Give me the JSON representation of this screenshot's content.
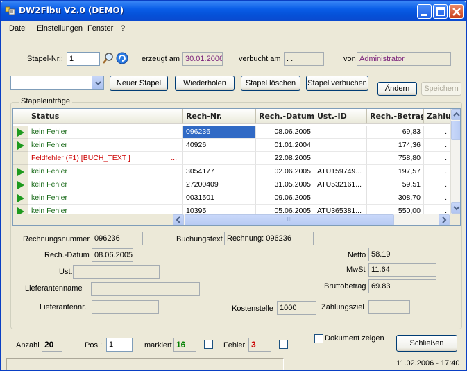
{
  "window": {
    "title": "DW2Fibu V2.0 (DEMO)"
  },
  "menu": [
    "Datei",
    "Einstellungen",
    "Fenster",
    "?"
  ],
  "header": {
    "stapel_label": "Stapel-Nr.:",
    "stapel_value": "1",
    "erzeugt_label": "erzeugt am",
    "erzeugt_value": "30.01.2006",
    "verbucht_label": "verbucht am",
    "verbucht_value": "  .  .",
    "von_label": "von",
    "von_value": "Administrator"
  },
  "toolbar": {
    "combo_value": "",
    "neuer_stapel": "Neuer Stapel",
    "wiederholen": "Wiederholen",
    "stapel_loeschen": "Stapel löschen",
    "stapel_verbuchen": "Stapel verbuchen",
    "aendern": "Ändern",
    "speichern": "Speichern"
  },
  "group_title": "Stapeleinträge",
  "table": {
    "columns": [
      "Status",
      "Rech-Nr.",
      "Rech.-Datum",
      "Ust.-ID",
      "Rech.-Betrag",
      "Zahlungs"
    ],
    "rows": [
      {
        "status": "kein Fehler",
        "error": false,
        "rechnr": "096236",
        "datum": "08.06.2005",
        "ustid": "",
        "betrag": "69,83",
        "zahl": ".",
        "selected": true
      },
      {
        "status": "kein Fehler",
        "error": false,
        "rechnr": "40926",
        "datum": "01.01.2004",
        "ustid": "",
        "betrag": "174,36",
        "zahl": ".",
        "selected": false
      },
      {
        "status": "Feldfehler (F1) [BUCH_TEXT ]",
        "status_more": "...",
        "error": true,
        "rechnr": "",
        "datum": "22.08.2005",
        "ustid": "",
        "betrag": "758,80",
        "zahl": ".",
        "selected": false
      },
      {
        "status": "kein Fehler",
        "error": false,
        "rechnr": "3054177",
        "datum": "02.06.2005",
        "ustid": "ATU159749...",
        "betrag": "197,57",
        "zahl": ".",
        "selected": false
      },
      {
        "status": "kein Fehler",
        "error": false,
        "rechnr": "27200409",
        "datum": "31.05.2005",
        "ustid": "ATU532161...",
        "betrag": "59,51",
        "zahl": ".",
        "selected": false
      },
      {
        "status": "kein Fehler",
        "error": false,
        "rechnr": "0031501",
        "datum": "09.06.2005",
        "ustid": "",
        "betrag": "308,70",
        "zahl": ".",
        "selected": false
      },
      {
        "status": "kein Fehler",
        "error": false,
        "rechnr": "10395",
        "datum": "05.06.2005",
        "ustid": "ATU365381...",
        "betrag": "550,00",
        "zahl": ".",
        "selected": false
      }
    ],
    "scroll_track_label": "III"
  },
  "detail": {
    "rechnungsnummer_label": "Rechnungsnummer",
    "rechnungsnummer_value": "096236",
    "buchungstext_label": "Buchungstext",
    "buchungstext_value": "Rechnung: 096236",
    "datum_label": "Rech.-Datum",
    "datum_value": "08.06.2005",
    "netto_label": "Netto",
    "netto_value": "58.19",
    "ustid_label": "Ust.-ID",
    "ustid_value": "",
    "mwst_label": "MwSt",
    "mwst_value": "11.64",
    "lieferantenname_label": "Lieferantenname",
    "lieferantenname_value": "",
    "brutto_label": "Bruttobetrag",
    "brutto_value": "69.83",
    "lieferantennr_label": "Lieferantennr.",
    "lieferantennr_value": "",
    "kostenstelle_label": "Kostenstelle",
    "kostenstelle_value": "1000",
    "zahlungsziel_label": "Zahlungsziel",
    "zahlungsziel_value": ""
  },
  "footer": {
    "anzahl_label": "Anzahl",
    "anzahl_value": "20",
    "pos_label": "Pos.:",
    "pos_value": "1",
    "markiert_label": "markiert",
    "markiert_value": "16",
    "fehler_label": "Fehler",
    "fehler_value": "3",
    "dokument_label": "Dokument zeigen",
    "schliessen": "Schließen"
  },
  "status": {
    "left": "",
    "datetime": "11.02.2006 - 17:40"
  },
  "colors": {
    "ok_text": "#1a6b1a",
    "error_text": "#cc0000",
    "selected_bg": "#316ac5",
    "markiert": "#008000",
    "fehler": "#cc0000"
  }
}
